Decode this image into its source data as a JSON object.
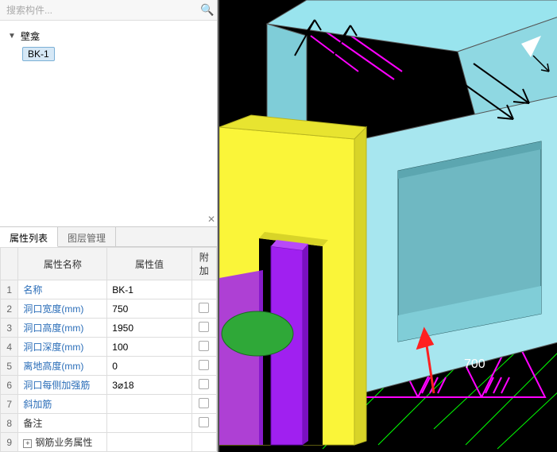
{
  "search": {
    "placeholder": "搜索构件..."
  },
  "tree": {
    "root_label": "壁龛",
    "item_label": "BK-1"
  },
  "tabs": {
    "props": "属性列表",
    "layers": "图层管理"
  },
  "table": {
    "headers": {
      "name": "属性名称",
      "value": "属性值",
      "extra": "附加"
    },
    "rows": [
      {
        "n": "1",
        "name": "名称",
        "value": "BK-1",
        "link": true,
        "chk": false
      },
      {
        "n": "2",
        "name": "洞口宽度(mm)",
        "value": "750",
        "link": true,
        "chk": true
      },
      {
        "n": "3",
        "name": "洞口高度(mm)",
        "value": "1950",
        "link": true,
        "chk": true
      },
      {
        "n": "4",
        "name": "洞口深度(mm)",
        "value": "100",
        "link": true,
        "chk": true
      },
      {
        "n": "5",
        "name": "离地高度(mm)",
        "value": "0",
        "link": true,
        "chk": true
      },
      {
        "n": "6",
        "name": "洞口每侧加强筋",
        "value": "3⌀18",
        "link": true,
        "chk": true
      },
      {
        "n": "7",
        "name": "斜加筋",
        "value": "",
        "link": true,
        "chk": true
      },
      {
        "n": "8",
        "name": "备注",
        "value": "",
        "link": false,
        "chk": true
      },
      {
        "n": "9",
        "name": "钢筋业务属性",
        "value": "",
        "link": false,
        "chk": false,
        "expand": true
      }
    ]
  },
  "viewport": {
    "dimension_label": "700",
    "colors": {
      "cyan": "#99e4ee",
      "yellow": "#faf539",
      "purple": "#a020f0",
      "magenta": "#ff00ff",
      "green_cyl": "#2fa838"
    }
  },
  "icons": {
    "search": "🔍",
    "close": "✕",
    "toggle_open": "▼"
  }
}
